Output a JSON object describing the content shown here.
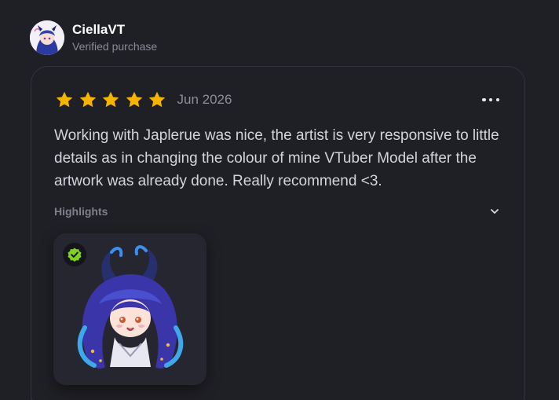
{
  "reviewer": {
    "name": "CiellaVT",
    "status": "Verified purchase",
    "avatar_icon": "vtuber-avatar"
  },
  "review": {
    "rating": 5,
    "rating_max": 5,
    "date": "Jun 2026",
    "text": "Working with Japlerue was nice, the artist is very responsive to little details as in changing the colour of mine VTuber Model after the artwork was already done. Really recommend <3.",
    "more_icon": "more-horizontal-icon"
  },
  "highlights": {
    "label": "Highlights",
    "toggle_icon": "chevron-down-icon"
  },
  "gallery": {
    "items": [
      {
        "subject": "VTuber chibi artwork",
        "badge_icon": "verified-check-icon"
      }
    ]
  },
  "colors": {
    "background": "#1f1f26",
    "star": "#f6b400",
    "verified_badge": "#7ed321",
    "muted_text": "#8b8b96"
  }
}
